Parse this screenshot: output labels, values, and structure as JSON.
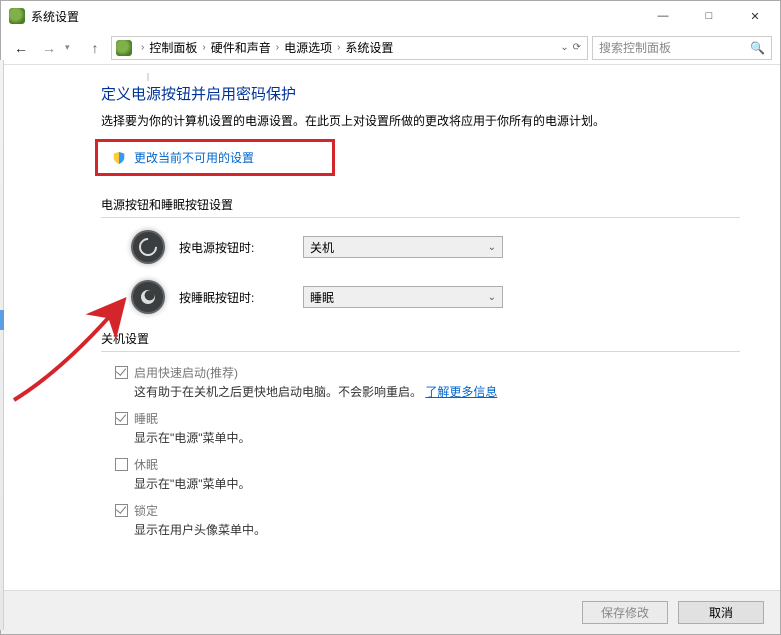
{
  "titlebar": {
    "title": "系统设置"
  },
  "breadcrumb": {
    "items": [
      "控制面板",
      "硬件和声音",
      "电源选项",
      "系统设置"
    ]
  },
  "search": {
    "placeholder": "搜索控制面板"
  },
  "main": {
    "heading": "定义电源按钮并启用密码保护",
    "subtext": "选择要为你的计算机设置的电源设置。在此页上对设置所做的更改将应用于你所有的电源计划。",
    "change_link": "更改当前不可用的设置",
    "section_buttons": "电源按钮和睡眠按钮设置",
    "power_button_label": "按电源按钮时:",
    "power_button_value": "关机",
    "sleep_button_label": "按睡眠按钮时:",
    "sleep_button_value": "睡眠",
    "section_shutdown": "关机设置",
    "opts": [
      {
        "label": "启用快速启动(推荐)",
        "desc_pre": "这有助于在关机之后更快地启动电脑。不会影响重启。",
        "desc_link": "了解更多信息",
        "checked": true
      },
      {
        "label": "睡眠",
        "desc_pre": "显示在\"电源\"菜单中。",
        "desc_link": "",
        "checked": true
      },
      {
        "label": "休眠",
        "desc_pre": "显示在\"电源\"菜单中。",
        "desc_link": "",
        "checked": false
      },
      {
        "label": "锁定",
        "desc_pre": "显示在用户头像菜单中。",
        "desc_link": "",
        "checked": true
      }
    ]
  },
  "footer": {
    "save": "保存修改",
    "cancel": "取消"
  }
}
